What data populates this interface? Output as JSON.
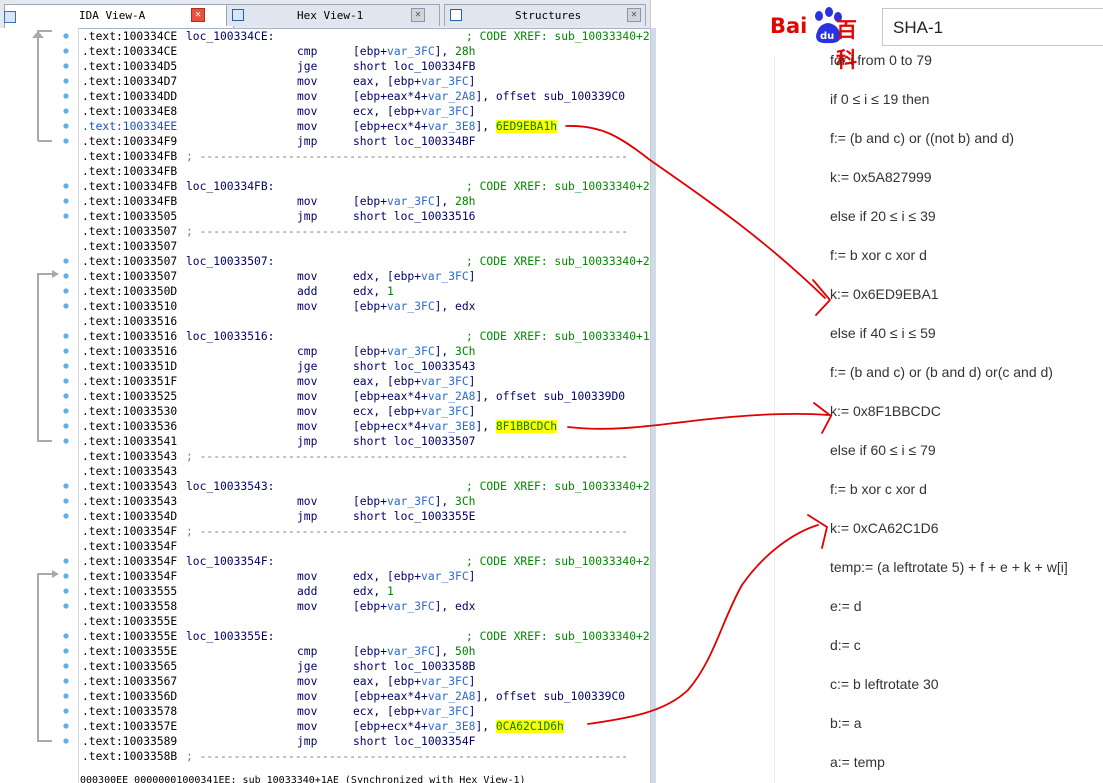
{
  "ida": {
    "tabs": [
      {
        "label": "IDA View-A",
        "active": true
      },
      {
        "label": "Hex View-1",
        "active": false
      },
      {
        "label": "Structures",
        "active": false
      }
    ],
    "lines": [
      {
        "addr": ".text:100334CE",
        "label": "loc_100334CE:",
        "xref": "; CODE XREF: sub_10033340+2"
      },
      {
        "addr": ".text:100334CE",
        "mnem": "cmp",
        "ops": [
          {
            "t": "[ebp+"
          },
          {
            "t": "var_3FC",
            "c": "v"
          },
          {
            "t": "], "
          },
          {
            "t": "28h",
            "c": "num"
          }
        ]
      },
      {
        "addr": ".text:100334D5",
        "mnem": "jge",
        "ops": [
          {
            "t": "short loc_100334FB"
          }
        ]
      },
      {
        "addr": ".text:100334D7",
        "mnem": "mov",
        "ops": [
          {
            "t": "eax, [ebp+"
          },
          {
            "t": "var_3FC",
            "c": "v"
          },
          {
            "t": "]"
          }
        ]
      },
      {
        "addr": ".text:100334DD",
        "mnem": "mov",
        "ops": [
          {
            "t": "[ebp+eax*4+"
          },
          {
            "t": "var_2A8",
            "c": "v"
          },
          {
            "t": "], offset sub_100339C0"
          }
        ]
      },
      {
        "addr": ".text:100334E8",
        "mnem": "mov",
        "ops": [
          {
            "t": "ecx, [ebp+"
          },
          {
            "t": "var_3FC",
            "c": "v"
          },
          {
            "t": "]"
          }
        ]
      },
      {
        "addr": ".text:100334EE",
        "addrhl": true,
        "mnem": "mov",
        "ops": [
          {
            "t": "[ebp+ecx*4+"
          },
          {
            "t": "var_3E8",
            "c": "v"
          },
          {
            "t": "], "
          },
          {
            "t": "6ED9EBA1h",
            "c": "hy"
          }
        ]
      },
      {
        "addr": ".text:100334F9",
        "mnem": "jmp",
        "ops": [
          {
            "t": "short loc_100334BF"
          }
        ]
      },
      {
        "addr": ".text:100334FB",
        "sep": "; ---------------------------------------------------------------"
      },
      {
        "addr": ".text:100334FB"
      },
      {
        "addr": ".text:100334FB",
        "label": "loc_100334FB:",
        "xref": "; CODE XREF: sub_10033340+2"
      },
      {
        "addr": ".text:100334FB",
        "mnem": "mov",
        "ops": [
          {
            "t": "[ebp+"
          },
          {
            "t": "var_3FC",
            "c": "v"
          },
          {
            "t": "], "
          },
          {
            "t": "28h",
            "c": "num"
          }
        ]
      },
      {
        "addr": ".text:10033505",
        "mnem": "jmp",
        "ops": [
          {
            "t": "short loc_10033516"
          }
        ]
      },
      {
        "addr": ".text:10033507",
        "sep": "; ---------------------------------------------------------------"
      },
      {
        "addr": ".text:10033507"
      },
      {
        "addr": ".text:10033507",
        "label": "loc_10033507:",
        "xref": "; CODE XREF: sub_10033340+2"
      },
      {
        "addr": ".text:10033507",
        "mnem": "mov",
        "ops": [
          {
            "t": "edx, [ebp+"
          },
          {
            "t": "var_3FC",
            "c": "v"
          },
          {
            "t": "]"
          }
        ]
      },
      {
        "addr": ".text:1003350D",
        "mnem": "add",
        "ops": [
          {
            "t": "edx, "
          },
          {
            "t": "1",
            "c": "num"
          }
        ]
      },
      {
        "addr": ".text:10033510",
        "mnem": "mov",
        "ops": [
          {
            "t": "[ebp+"
          },
          {
            "t": "var_3FC",
            "c": "v"
          },
          {
            "t": "], edx"
          }
        ]
      },
      {
        "addr": ".text:10033516"
      },
      {
        "addr": ".text:10033516",
        "label": "loc_10033516:",
        "xref": "; CODE XREF: sub_10033340+1"
      },
      {
        "addr": ".text:10033516",
        "mnem": "cmp",
        "ops": [
          {
            "t": "[ebp+"
          },
          {
            "t": "var_3FC",
            "c": "v"
          },
          {
            "t": "], "
          },
          {
            "t": "3Ch",
            "c": "num"
          }
        ]
      },
      {
        "addr": ".text:1003351D",
        "mnem": "jge",
        "ops": [
          {
            "t": "short loc_10033543"
          }
        ]
      },
      {
        "addr": ".text:1003351F",
        "mnem": "mov",
        "ops": [
          {
            "t": "eax, [ebp+"
          },
          {
            "t": "var_3FC",
            "c": "v"
          },
          {
            "t": "]"
          }
        ]
      },
      {
        "addr": ".text:10033525",
        "mnem": "mov",
        "ops": [
          {
            "t": "[ebp+eax*4+"
          },
          {
            "t": "var_2A8",
            "c": "v"
          },
          {
            "t": "], offset sub_100339D0"
          }
        ]
      },
      {
        "addr": ".text:10033530",
        "mnem": "mov",
        "ops": [
          {
            "t": "ecx, [ebp+"
          },
          {
            "t": "var_3FC",
            "c": "v"
          },
          {
            "t": "]"
          }
        ]
      },
      {
        "addr": ".text:10033536",
        "mnem": "mov",
        "ops": [
          {
            "t": "[ebp+ecx*4+"
          },
          {
            "t": "var_3E8",
            "c": "v"
          },
          {
            "t": "], "
          },
          {
            "t": "8F1BBCDCh",
            "c": "hy"
          }
        ]
      },
      {
        "addr": ".text:10033541",
        "mnem": "jmp",
        "ops": [
          {
            "t": "short loc_10033507"
          }
        ]
      },
      {
        "addr": ".text:10033543",
        "sep": "; ---------------------------------------------------------------"
      },
      {
        "addr": ".text:10033543"
      },
      {
        "addr": ".text:10033543",
        "label": "loc_10033543:",
        "xref": "; CODE XREF: sub_10033340+2"
      },
      {
        "addr": ".text:10033543",
        "mnem": "mov",
        "ops": [
          {
            "t": "[ebp+"
          },
          {
            "t": "var_3FC",
            "c": "v"
          },
          {
            "t": "], "
          },
          {
            "t": "3Ch",
            "c": "num"
          }
        ]
      },
      {
        "addr": ".text:1003354D",
        "mnem": "jmp",
        "ops": [
          {
            "t": "short loc_1003355E"
          }
        ]
      },
      {
        "addr": ".text:1003354F",
        "sep": "; ---------------------------------------------------------------"
      },
      {
        "addr": ".text:1003354F"
      },
      {
        "addr": ".text:1003354F",
        "label": "loc_1003354F:",
        "xref": "; CODE XREF: sub_10033340+2"
      },
      {
        "addr": ".text:1003354F",
        "mnem": "mov",
        "ops": [
          {
            "t": "edx, [ebp+"
          },
          {
            "t": "var_3FC",
            "c": "v"
          },
          {
            "t": "]"
          }
        ]
      },
      {
        "addr": ".text:10033555",
        "mnem": "add",
        "ops": [
          {
            "t": "edx, "
          },
          {
            "t": "1",
            "c": "num"
          }
        ]
      },
      {
        "addr": ".text:10033558",
        "mnem": "mov",
        "ops": [
          {
            "t": "[ebp+"
          },
          {
            "t": "var_3FC",
            "c": "v"
          },
          {
            "t": "], edx"
          }
        ]
      },
      {
        "addr": ".text:1003355E"
      },
      {
        "addr": ".text:1003355E",
        "label": "loc_1003355E:",
        "xref": "; CODE XREF: sub_10033340+2"
      },
      {
        "addr": ".text:1003355E",
        "mnem": "cmp",
        "ops": [
          {
            "t": "[ebp+"
          },
          {
            "t": "var_3FC",
            "c": "v"
          },
          {
            "t": "], "
          },
          {
            "t": "50h",
            "c": "num"
          }
        ]
      },
      {
        "addr": ".text:10033565",
        "mnem": "jge",
        "ops": [
          {
            "t": "short loc_1003358B"
          }
        ]
      },
      {
        "addr": ".text:10033567",
        "mnem": "mov",
        "ops": [
          {
            "t": "eax, [ebp+"
          },
          {
            "t": "var_3FC",
            "c": "v"
          },
          {
            "t": "]"
          }
        ]
      },
      {
        "addr": ".text:1003356D",
        "mnem": "mov",
        "ops": [
          {
            "t": "[ebp+eax*4+"
          },
          {
            "t": "var_2A8",
            "c": "v"
          },
          {
            "t": "], offset sub_100339C0"
          }
        ]
      },
      {
        "addr": ".text:10033578",
        "mnem": "mov",
        "ops": [
          {
            "t": "ecx, [ebp+"
          },
          {
            "t": "var_3FC",
            "c": "v"
          },
          {
            "t": "]"
          }
        ]
      },
      {
        "addr": ".text:1003357E",
        "mnem": "mov",
        "ops": [
          {
            "t": "[ebp+ecx*4+"
          },
          {
            "t": "var_3E8",
            "c": "v"
          },
          {
            "t": "], "
          },
          {
            "t": "0CA62C1D6h",
            "c": "hy"
          }
        ]
      },
      {
        "addr": ".text:10033589",
        "mnem": "jmp",
        "ops": [
          {
            "t": "short loc_1003354F"
          }
        ]
      },
      {
        "addr": ".text:1003358B",
        "sep": "; ---------------------------------------------------------------"
      }
    ],
    "status_line": "000300EE 00000001000341EE: sub_10033340+1AE (Synchronized with Hex View-1)"
  },
  "baidu": {
    "logo_text_left": "Bai",
    "logo_paw_text": "du",
    "logo_text_right": "百科",
    "search_value": "SHA-1",
    "algorithm_lines": [
      "for i from 0 to 79",
      "if 0 ≤ i ≤ 19 then",
      "f:= (b and c) or ((not b) and d)",
      "k:= 0x5A827999",
      "else if 20 ≤ i ≤ 39",
      "f:= b xor c xor d",
      "k:= 0x6ED9EBA1",
      "else if 40 ≤ i ≤ 59",
      "f:= (b and c) or (b and d) or(c and d)",
      "k:= 0x8F1BBCDC",
      "else if 60 ≤ i ≤ 79",
      "f:= b xor c xor d",
      "k:= 0xCA62C1D6",
      "temp:= (a leftrotate 5) + f + e + k + w[i]",
      "e:= d",
      "d:= c",
      "c:= b leftrotate 30",
      "b:= a",
      "a:= temp"
    ]
  },
  "colors": {
    "annotation": "#e00000",
    "highlight": "#ffff00",
    "baidu_red": "#e10602",
    "baidu_blue": "#2932e1"
  }
}
